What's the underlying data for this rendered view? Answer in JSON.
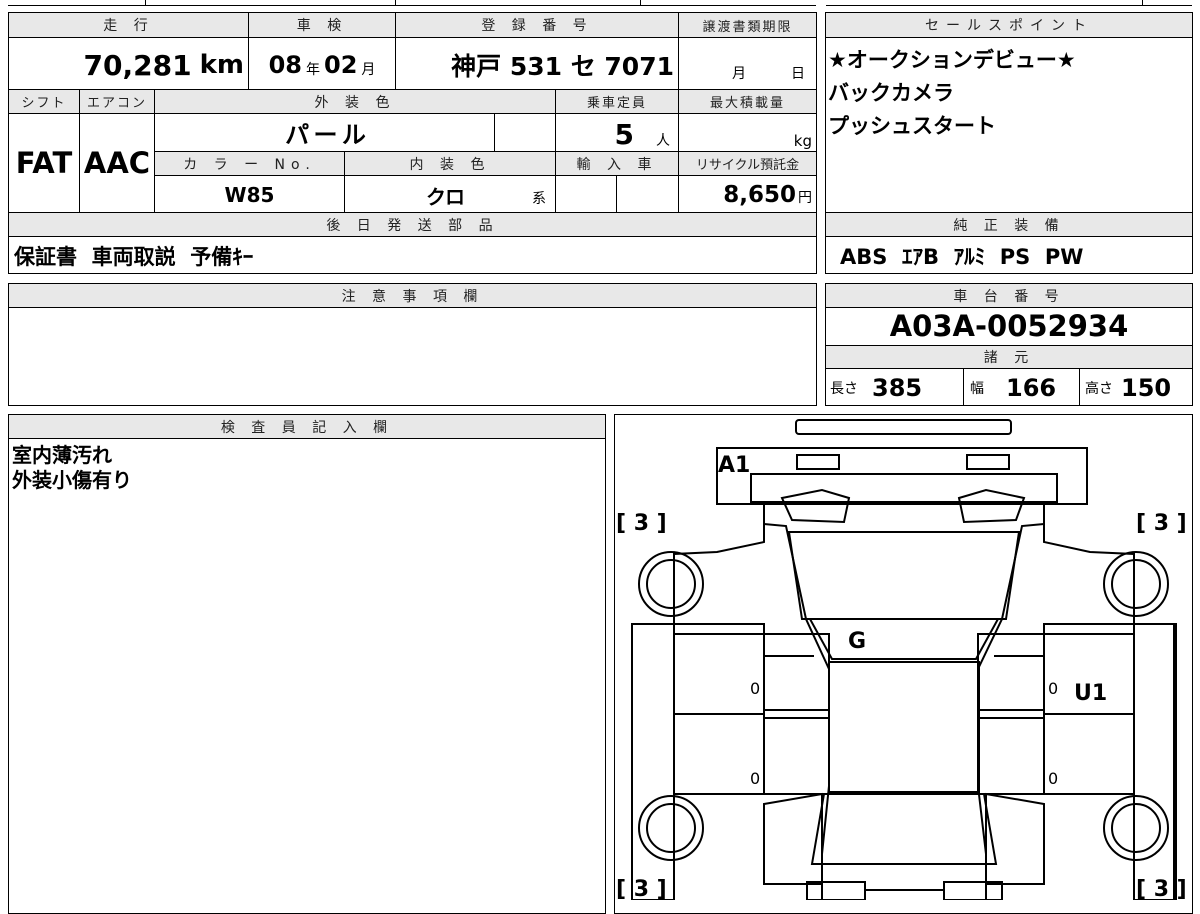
{
  "vehicle": {
    "mileage_label": "走 行",
    "mileage_value": "70,281",
    "mileage_unit": "km",
    "inspection_label": "車 検",
    "inspection_year": "08",
    "inspection_year_unit": "年",
    "inspection_month": "02",
    "inspection_month_unit": "月",
    "registration_label": "登 録 番 号",
    "registration_value": "神戸 531 セ 7071",
    "transfer_label": "譲渡書類期限",
    "transfer_month_unit": "月",
    "transfer_day_unit": "日",
    "shift_label": "シフト",
    "shift_value": "FAT",
    "ac_label": "エアコン",
    "ac_value": "AAC",
    "exterior_label": "外 装 色",
    "exterior_value": "パ ー ル",
    "capacity_label": "乗車定員",
    "capacity_value": "5",
    "capacity_unit": "人",
    "max_load_label": "最大積載量",
    "max_load_unit": "kg",
    "color_no_label": "カ ラ ー No.",
    "color_no_value": "W85",
    "interior_label": "内 装 色",
    "interior_value": "クロ",
    "interior_unit": "系",
    "import_label": "輸 入 車",
    "recycle_label": "リサイクル預託金",
    "recycle_value": "8,650",
    "recycle_unit": "円",
    "shipment_label": "後 日 発 送 部 品",
    "shipment_value": "保証書  車両取説  予備ｷｰ",
    "notes_label": "注 意 事 項 欄",
    "inspector_label": "検 査 員 記 入 欄",
    "inspector_lines": [
      "室内薄汚れ",
      "外装小傷有り"
    ]
  },
  "sales": {
    "label": "セールスポイント",
    "lines": [
      "★オークションデビュー★",
      "バックカメラ",
      "プッシュスタート"
    ]
  },
  "equipment": {
    "label": "純 正 装 備",
    "value": "ABS  ｴｱB  ｱﾙﾐ  PS  PW"
  },
  "chassis": {
    "label": "車 台 番 号",
    "value": "A03A-0052934"
  },
  "specs": {
    "label": "諸 元",
    "length_label": "長さ",
    "length_value": "385",
    "width_label": "幅",
    "width_value": "166",
    "height_label": "高さ",
    "height_value": "150"
  },
  "diagram": {
    "marks": {
      "a1": "A1",
      "g": "G",
      "u1": "U1"
    },
    "tires": {
      "front_left": "[ 3 ]",
      "front_right": "[ 3 ]",
      "rear_left": "[ 3 ]",
      "rear_right": "[ 3 ]"
    },
    "panels": {
      "left_front_door": "0",
      "left_rear_door": "0",
      "right_front_door": "0",
      "right_rear_door": "0"
    }
  }
}
